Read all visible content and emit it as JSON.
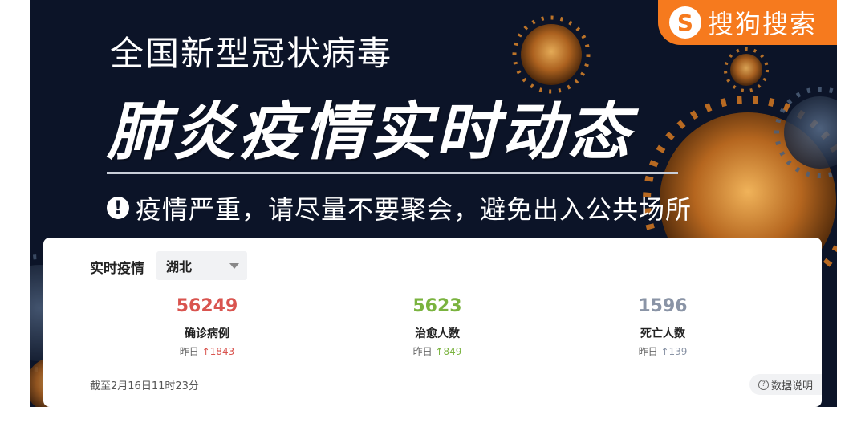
{
  "banner": {
    "logo_mark": "S",
    "logo_text": "搜狗搜索",
    "headline_line1": "全国新型冠状病毒",
    "headline_line2": "肺炎疫情实时动态",
    "notice_icon": "exclamation-icon",
    "notice": "疫情严重，请尽量不要聚会，避免出入公共场所"
  },
  "card": {
    "title": "实时疫情",
    "region_select": "湖北",
    "stats": [
      {
        "value": "56249",
        "label": "确诊病例",
        "yesterday_label": "昨日",
        "arrow": "↑",
        "delta": "1843",
        "color": "#d9544f"
      },
      {
        "value": "5623",
        "label": "治愈人数",
        "yesterday_label": "昨日",
        "arrow": "↑",
        "delta": "849",
        "color": "#7ab33f"
      },
      {
        "value": "1596",
        "label": "死亡人数",
        "yesterday_label": "昨日",
        "arrow": "↑",
        "delta": "139",
        "color": "#8a94a6"
      }
    ],
    "timestamp": "截至2月16日11时23分",
    "data_desc_icon": "question-icon",
    "data_desc": "数据说明"
  },
  "colors": {
    "brand_orange": "#f67a1e",
    "banner_bg": "#0c1428"
  }
}
